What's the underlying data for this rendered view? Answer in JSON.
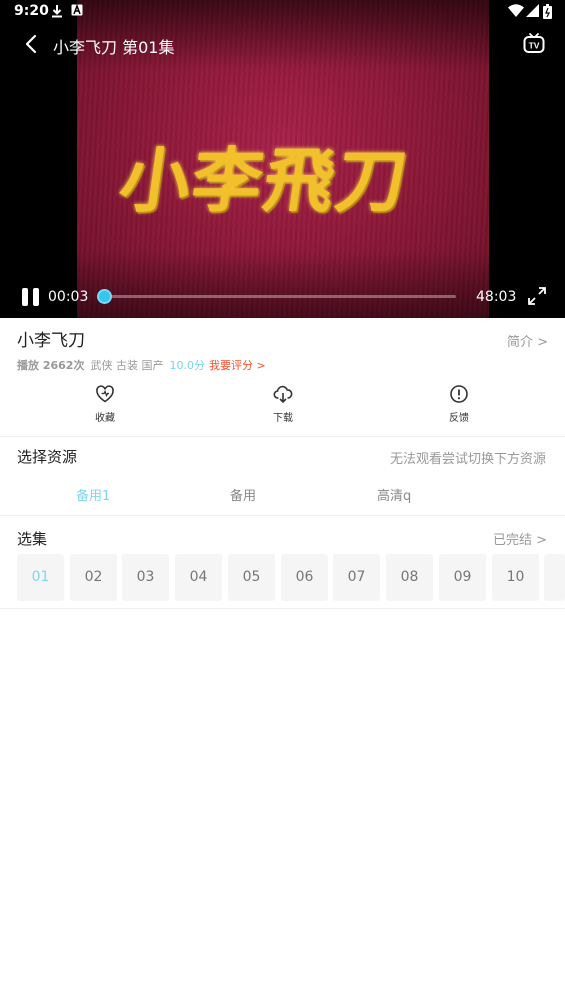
{
  "status_bar": {
    "time": "9:20"
  },
  "player": {
    "episode_title": "小李飞刀 第01集",
    "title_art_text": "小李飛刀",
    "current_time": "00:03",
    "duration": "48:03",
    "progress": 0.001
  },
  "show": {
    "title": "小李飞刀",
    "intro_label": "简介 >",
    "plays": "播放 2662次",
    "tags": "武侠 古装 国产",
    "score": "10.0分",
    "rate_label": "我要评分 >"
  },
  "actions": [
    {
      "label": "收藏",
      "icon": "heart-icon"
    },
    {
      "label": "下载",
      "icon": "cloud-download-icon"
    },
    {
      "label": "反馈",
      "icon": "alert-circle-icon"
    }
  ],
  "sources": {
    "title": "选择资源",
    "hint": "无法观看尝试切换下方资源",
    "items": [
      "备用1",
      "备用",
      "高清q"
    ],
    "selected": "备用1"
  },
  "episodes": {
    "title": "选集",
    "status": "已完结 >",
    "items": [
      "01",
      "02",
      "03",
      "04",
      "05",
      "06",
      "07",
      "08",
      "09",
      "10"
    ],
    "selected": "01"
  },
  "colors": {
    "accent": "#35c6ee",
    "rate": "#f2532e",
    "score": "#76d4f0"
  }
}
